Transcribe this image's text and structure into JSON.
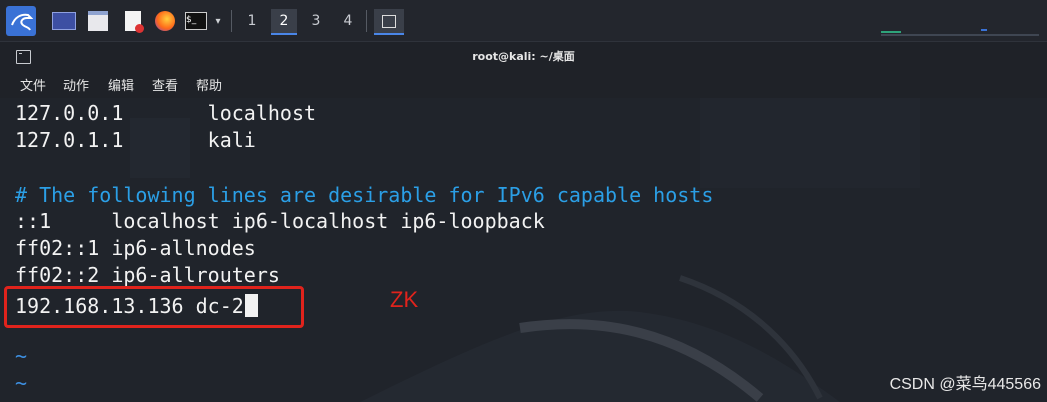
{
  "taskbar": {
    "workspaces": [
      {
        "label": "1",
        "active": false
      },
      {
        "label": "2",
        "active": true
      },
      {
        "label": "3",
        "active": false
      },
      {
        "label": "4",
        "active": false
      }
    ]
  },
  "window": {
    "title": "root@kali: ~/桌面",
    "menu": [
      "文件",
      "动作",
      "编辑",
      "查看",
      "帮助"
    ]
  },
  "terminal": {
    "lines": [
      "127.0.0.1       localhost",
      "127.0.1.1       kali",
      "",
      "# The following lines are desirable for IPv6 capable hosts",
      "::1     localhost ip6-localhost ip6-loopback",
      "ff02::1 ip6-allnodes",
      "ff02::2 ip6-allrouters",
      "192.168.13.136 dc-2",
      "~",
      "~"
    ]
  },
  "annotation": {
    "label": "ZK",
    "color": "#e0231c"
  },
  "watermark": "CSDN @菜鸟445566",
  "colors": {
    "comment": "#2b9fe6",
    "tilde": "#3d8fe0",
    "accent": "#3a72d6"
  }
}
